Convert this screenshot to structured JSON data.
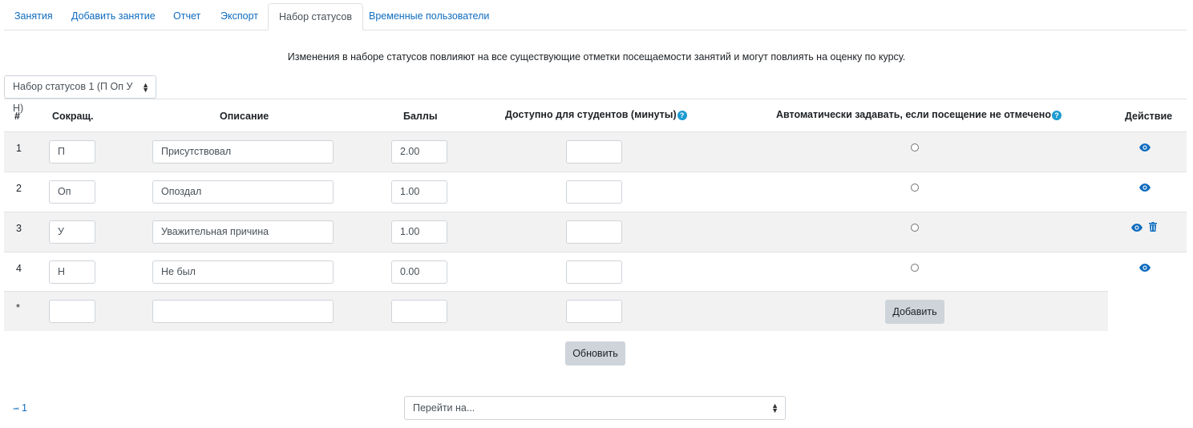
{
  "tabs": [
    {
      "label": "Занятия"
    },
    {
      "label": "Добавить занятие"
    },
    {
      "label": "Отчет"
    },
    {
      "label": "Экспорт"
    },
    {
      "label": "Набор статусов",
      "active": true
    },
    {
      "label": "Временные пользователи"
    }
  ],
  "notice": "Изменения в наборе статусов повлияют на все существующие отметки посещаемости занятий и могут повлиять на оценку по курсу.",
  "status_set_select": "Набор статусов 1 (П Оп У Н)",
  "table": {
    "headers": {
      "num": "#",
      "acronym": "Сокращ.",
      "description": "Описание",
      "grade": "Баллы",
      "available": "Доступно для студентов (минуты)",
      "auto": "Автоматически задавать, если посещение не отмечено",
      "action": "Действие"
    },
    "rows": [
      {
        "num": "1",
        "acronym": "П",
        "description": "Присутствовал",
        "grade": "2.00",
        "available": ""
      },
      {
        "num": "2",
        "acronym": "Оп",
        "description": "Опоздал",
        "grade": "1.00",
        "available": ""
      },
      {
        "num": "3",
        "acronym": "У",
        "description": "Уважительная причина",
        "grade": "1.00",
        "available": ""
      },
      {
        "num": "4",
        "acronym": "Н",
        "description": "Не был",
        "grade": "0.00",
        "available": ""
      }
    ],
    "new_row": {
      "num": "*",
      "add_label": "Добавить"
    }
  },
  "update_label": "Обновить",
  "pager_label": "1",
  "jump_select": "Перейти на...",
  "colors": {
    "link": "#0f6cbf",
    "help": "#1b9bd1",
    "button": "#ced4da",
    "stripe": "#f2f2f2"
  },
  "icons": [
    "eye-icon",
    "trash-icon",
    "help-icon",
    "sort-arrows-icon",
    "first-page-arrow-icon"
  ]
}
